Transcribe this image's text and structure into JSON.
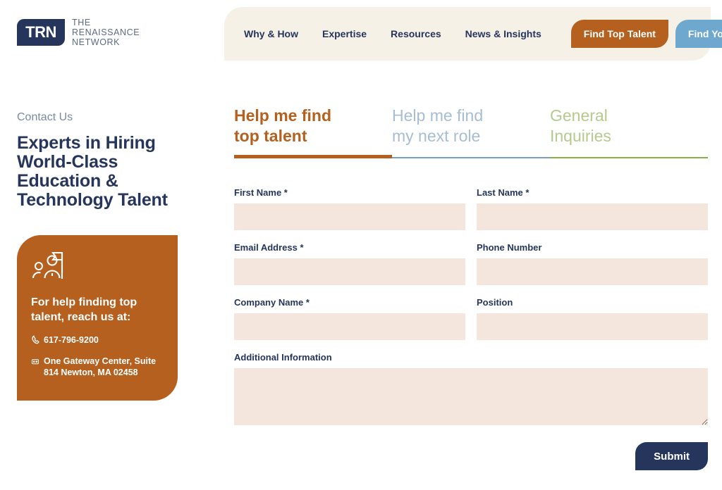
{
  "header": {
    "logo": {
      "mark_text": "TRN",
      "line1": "THE",
      "line2": "RENAISSANCE",
      "line3": "NETWORK"
    },
    "nav_links": [
      {
        "label": "Why & How"
      },
      {
        "label": "Expertise"
      },
      {
        "label": "Resources"
      },
      {
        "label": "News & Insights"
      }
    ],
    "cta_primary": {
      "label": "Find Top Talent",
      "color": "#b5601f"
    },
    "cta_secondary": {
      "label": "Find Your Role",
      "color": "#6ea8ce"
    },
    "nav_background": "#f6f1e7"
  },
  "left_column": {
    "eyebrow": "Contact Us",
    "title": "Experts in Hiring World-Class Education & Technology Talent",
    "card": {
      "background": "#b5601f",
      "icon": "people-with-flag-icon",
      "heading": "For help finding top talent, reach us at:",
      "phone": "617-796-9200",
      "address": "One Gateway Center, Suite 814 Newton, MA 02458"
    }
  },
  "form": {
    "tabs": [
      {
        "label": "Help me find\ntop talent",
        "color": "#b5601f",
        "active": true
      },
      {
        "label": "Help me find\nmy next role",
        "color": "#a8bdd2",
        "active": false
      },
      {
        "label": "General\nInquiries",
        "color": "#b4ca8e",
        "active": false
      }
    ],
    "fields": [
      {
        "label": "First Name *",
        "value": "",
        "placeholder": ""
      },
      {
        "label": "Last Name *",
        "value": "",
        "placeholder": ""
      },
      {
        "label": "Email Address *",
        "value": "",
        "placeholder": ""
      },
      {
        "label": "Phone Number",
        "value": "",
        "placeholder": ""
      },
      {
        "label": "Company Name *",
        "value": "",
        "placeholder": ""
      },
      {
        "label": "Position",
        "value": "",
        "placeholder": ""
      },
      {
        "label": "Additional Information",
        "value": "",
        "placeholder": ""
      }
    ],
    "submit_label": "Submit",
    "input_background": "#f5e6dd",
    "submit_color": "#25355c"
  }
}
